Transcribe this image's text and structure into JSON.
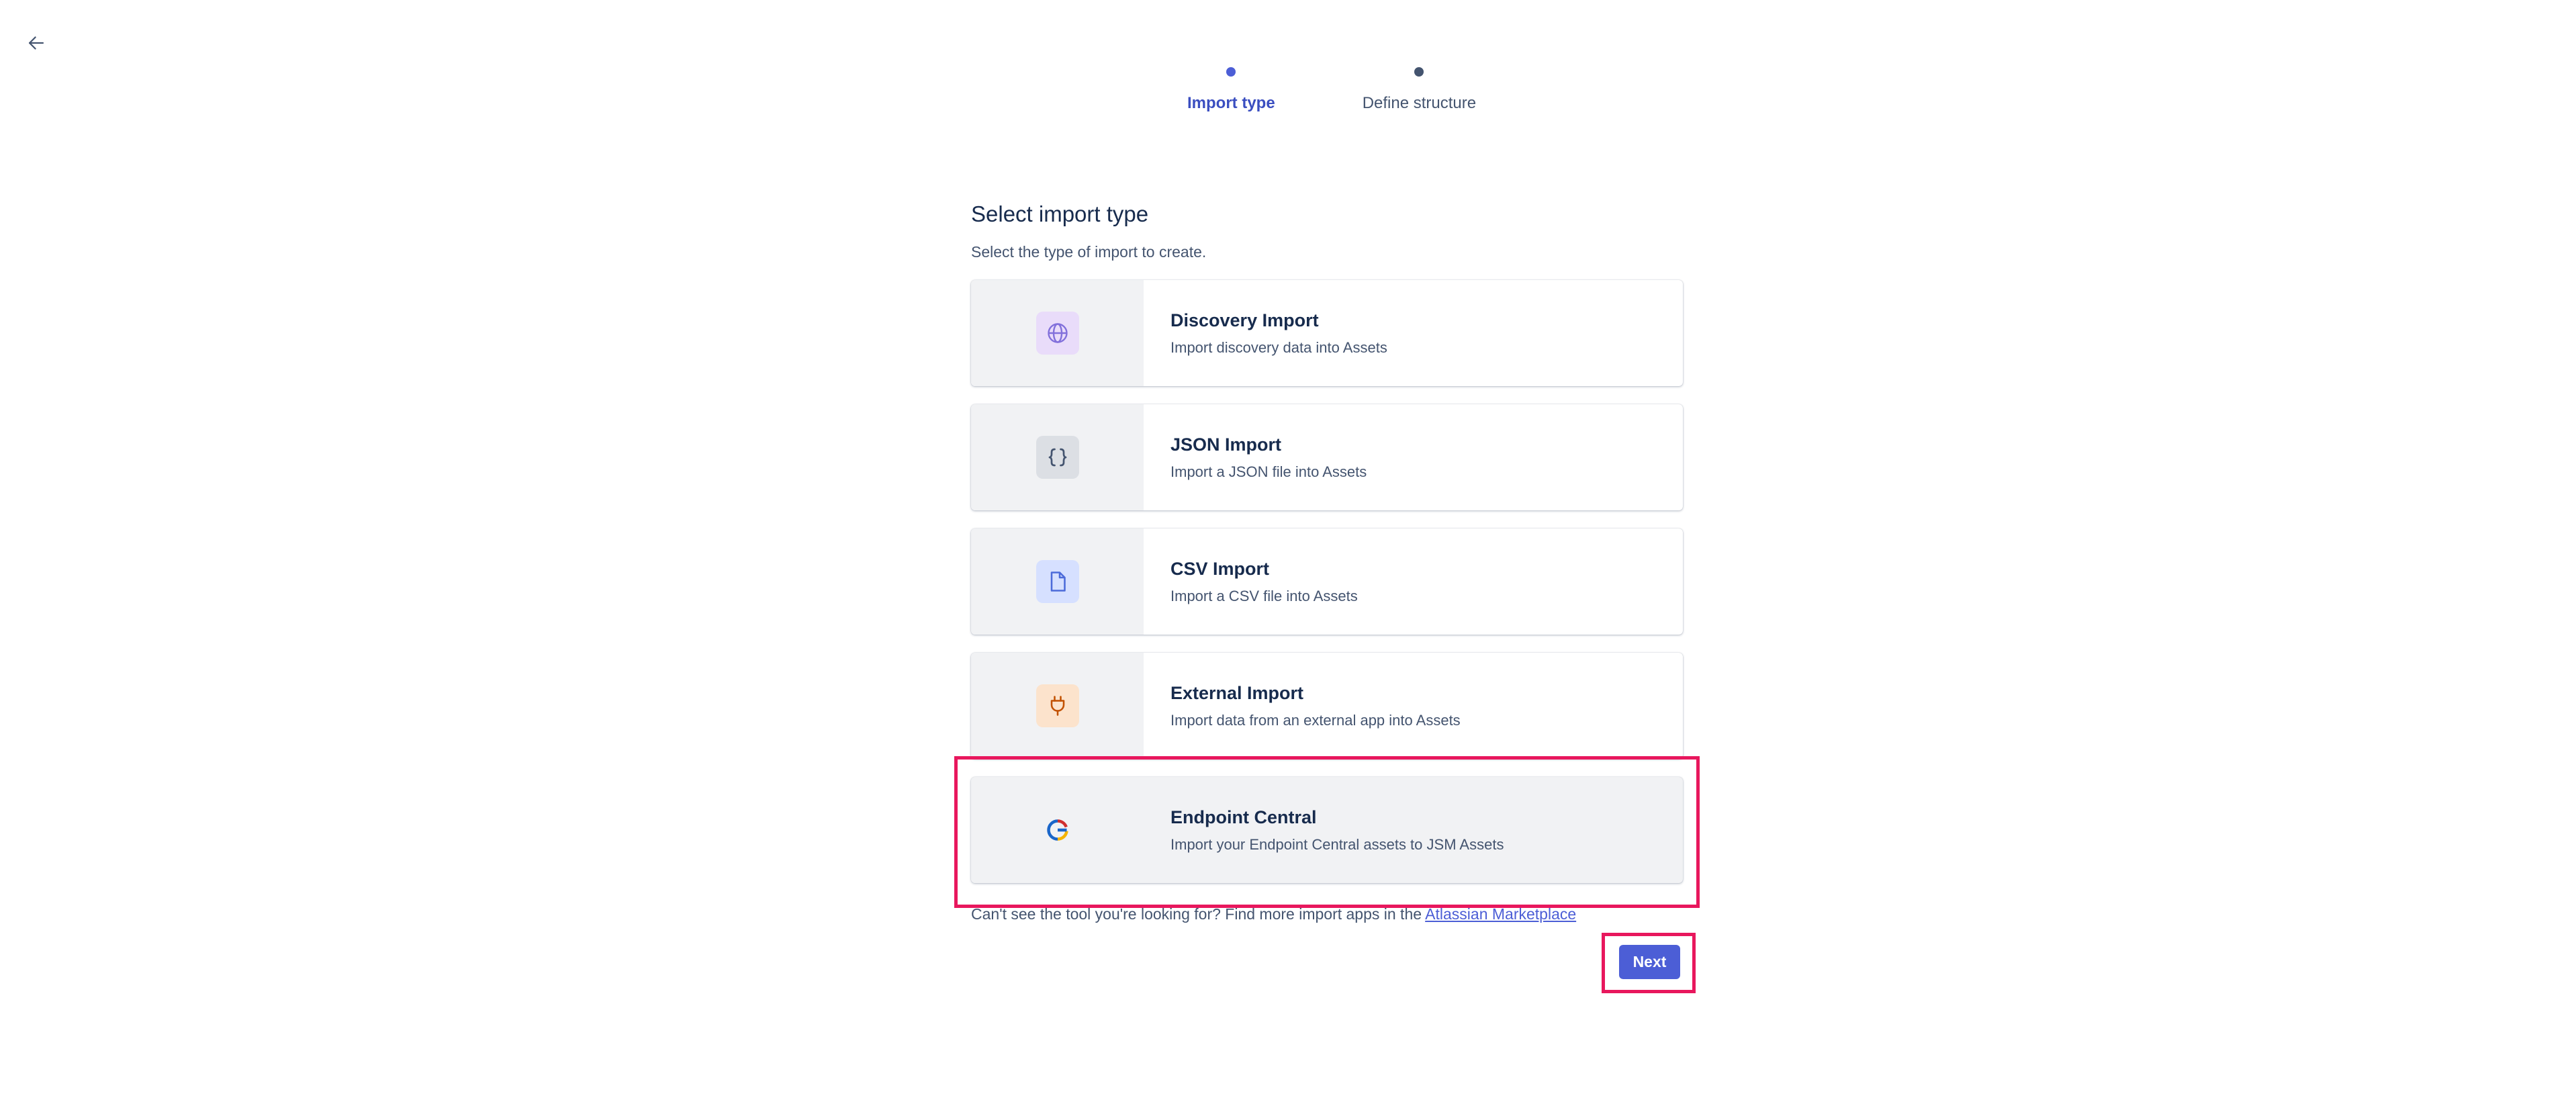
{
  "stepper": {
    "steps": [
      {
        "label": "Import type",
        "active": true
      },
      {
        "label": "Define structure",
        "active": false
      }
    ]
  },
  "main": {
    "title": "Select import type",
    "subtitle": "Select the type of import to create.",
    "options": [
      {
        "title": "Discovery Import",
        "description": "Import discovery data into Assets",
        "icon": "globe-icon",
        "icon_bg": "#e9dcfa",
        "icon_color": "#8270db"
      },
      {
        "title": "JSON Import",
        "description": "Import a JSON file into Assets",
        "icon": "braces-icon",
        "icon_bg": "#dcdfe4",
        "icon_color": "#44546f"
      },
      {
        "title": "CSV Import",
        "description": "Import a CSV file into Assets",
        "icon": "file-icon",
        "icon_bg": "#d6e0ff",
        "icon_color": "#4c6bd9"
      },
      {
        "title": "External Import",
        "description": "Import data from an external app into Assets",
        "icon": "plug-icon",
        "icon_bg": "#fce3cc",
        "icon_color": "#c25100"
      },
      {
        "title": "Endpoint Central",
        "description": "Import your Endpoint Central assets to JSM Assets",
        "icon": "endpoint-central-logo-icon",
        "selected": true
      }
    ],
    "marketplace_text": "Can't see the tool you're looking for? Find more import apps in the ",
    "marketplace_link": "Atlassian Marketplace"
  },
  "footer": {
    "next_label": "Next"
  },
  "colors": {
    "primary": "#4c5ed6",
    "highlight": "#e8175d"
  }
}
